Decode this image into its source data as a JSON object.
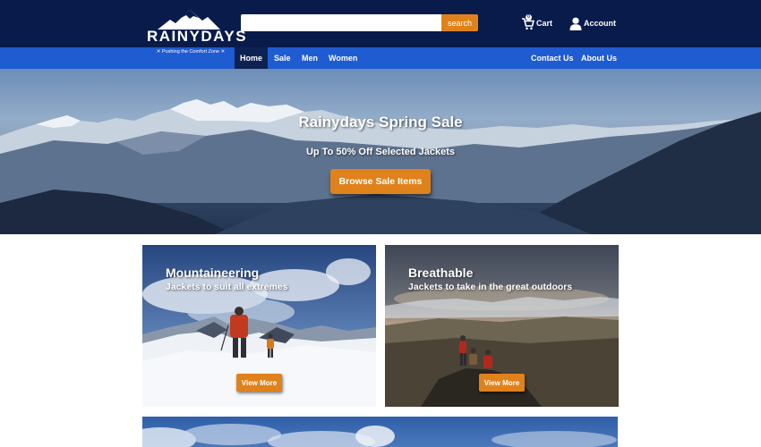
{
  "header": {
    "logo_text": "RAINYDAYS",
    "tagline": "✕ Pushing the Comfort Zone ✕",
    "search": {
      "placeholder": "",
      "button_label": "search"
    },
    "cart": {
      "label": "Cart",
      "badge": "0",
      "icon": "shopping-cart-icon"
    },
    "account": {
      "label": "Account",
      "icon": "user-icon"
    }
  },
  "nav": {
    "items": [
      {
        "label": "Home",
        "active": true
      },
      {
        "label": "Sale"
      },
      {
        "label": "Men"
      },
      {
        "label": "Women"
      }
    ],
    "right_items": [
      {
        "label": "Contact Us"
      },
      {
        "label": "About Us"
      }
    ]
  },
  "hero": {
    "title": "Rainydays Spring Sale",
    "subtitle": "Up To 50% Off Selected Jackets",
    "button_label": "Browse Sale Items"
  },
  "cards": [
    {
      "title": "Mountaineering",
      "subtitle": "Jackets to suit all extremes",
      "button_label": "View More"
    },
    {
      "title": "Breathable",
      "subtitle": "Jackets to take in the great outdoors",
      "button_label": "View More"
    }
  ],
  "colors": {
    "header_bg": "#091b4a",
    "nav_bg": "#1f5bd1",
    "nav_active_bg": "#0d2252",
    "accent": "#e0821b"
  }
}
